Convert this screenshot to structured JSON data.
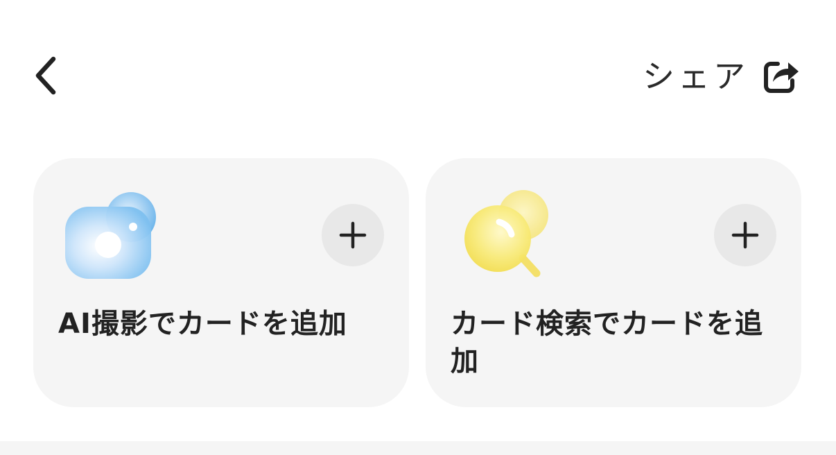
{
  "header": {
    "back_icon": "chevron-left-icon",
    "share_label": "シェア",
    "share_icon": "share-box-icon"
  },
  "cards": [
    {
      "title": "AI撮影でカードを追加",
      "icon": "camera-icon",
      "icon_color": "#6cb8ef",
      "add_icon": "plus-icon"
    },
    {
      "title": "カード検索でカードを追加",
      "icon": "magnifier-icon",
      "icon_color": "#f5e265",
      "add_icon": "plus-icon"
    }
  ],
  "colors": {
    "card_background": "#f5f5f5",
    "add_button_background": "#e8e8e8",
    "text": "#222222"
  }
}
